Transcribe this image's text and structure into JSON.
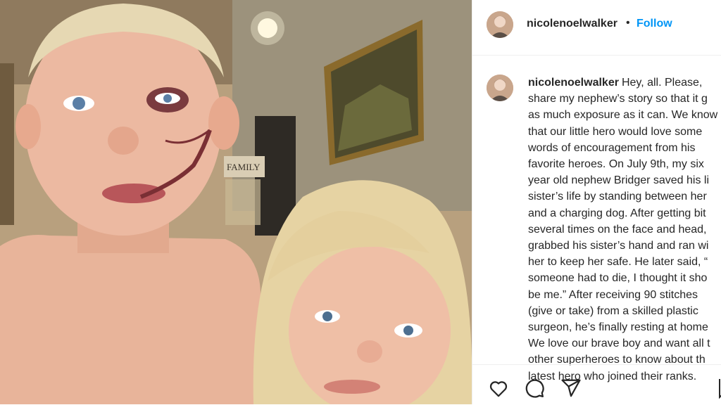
{
  "post": {
    "username": "nicolenoelwalker",
    "separator": "•",
    "follow_label": "Follow"
  },
  "caption": {
    "username": "nicolenoelwalker",
    "lines": [
      "Hey, all. Please,",
      "share my nephew’s story so that it g",
      "as much exposure as it can. We know",
      "that our little hero would love some",
      "words of encouragement from his",
      "favorite heroes. On July 9th, my six",
      "year old nephew Bridger saved his li",
      "sister’s life by standing between her",
      "and a charging dog. After getting bit",
      "several times on the face and head,",
      "grabbed his sister’s hand and ran wi",
      "her to keep her safe. He later said, “",
      "someone had to die, I thought it sho",
      "be me.” After receiving 90 stitches",
      "(give or take) from a skilled plastic",
      "surgeon, he’s finally resting at home",
      "We love our brave boy and want all t",
      "other superheroes to know about th",
      "latest hero who joined their ranks."
    ]
  },
  "photo": {
    "wall_sign": "FAMILY"
  },
  "icons": {
    "like": "heart-icon",
    "comment": "comment-icon",
    "share": "share-icon"
  },
  "colors": {
    "follow": "#0095f6",
    "text": "#262626",
    "divider": "#efefef"
  }
}
